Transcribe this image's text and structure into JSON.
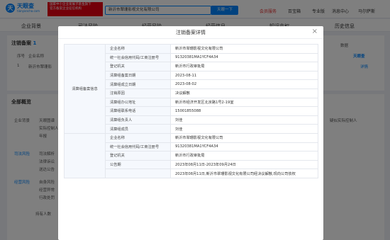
{
  "header": {
    "logo_mark": "天",
    "logo_name": "天眼查",
    "logo_url": "tianyancha.com",
    "promo_line1": "国家中小企业发展子基金旗下",
    "promo_line2": "官方备案企业征信机构",
    "search_value": "新沂市翠珊影视文化有限公司",
    "search_button": "天眼一下",
    "nav_vip": "会员服务",
    "nav_bt": "百宝箱",
    "nav_pro": "专业版",
    "nav_msg": "消息中心",
    "nav_user": "马尔萨斯"
  },
  "tabs": [
    "企业背景",
    "司法风险",
    "经营风险",
    "经营信息",
    "知识产权",
    "历史信息"
  ],
  "background": {
    "cancel_section": {
      "title": "注销备案",
      "count": "1"
    },
    "table_head": [
      "序号",
      "企业名称"
    ],
    "row": {
      "index": "1",
      "name_partial": "新沂市翠珊影"
    },
    "right_count_label": "数据",
    "right_more": "详情",
    "right_logo": "天眼查",
    "overview_title": "全部概览",
    "rows": [
      {
        "label": "企业背景",
        "sub": "天眼图谱",
        "sub2": "实际控制人",
        "sub3": "年报"
      },
      {
        "label": "司法风险",
        "sub": "司法解析",
        "sub2": "法律诉讼",
        "sub3": "送达公告"
      },
      {
        "label": "经营风险",
        "sub": "自身风险",
        "sub2": "经营异常",
        "sub3": "行政处罚"
      }
    ],
    "right_labels": [
      "疑似实际控制人"
    ],
    "tracking_label": "持有人数"
  },
  "modal": {
    "title": "注销备案详情",
    "group_label": "清算组备案信息",
    "rows": [
      {
        "label": "企业名称",
        "value": "新沂市翠珊影视文化有限公司"
      },
      {
        "label": "统一社会信用代码/工商注册号",
        "value": "91320381MA1YCF4A34"
      },
      {
        "label": "登记机关",
        "value": "新沂市行政审批局"
      },
      {
        "label": "清算组备案日期",
        "value": "2023-08-11"
      },
      {
        "label": "清算组成立日期",
        "value": "2023-08-02"
      },
      {
        "label": "注销原因",
        "value": "决议解散"
      },
      {
        "label": "清算组办公地址",
        "value": "新沂市经济开发区北京路1号2-19室"
      },
      {
        "label": "清算组联系电话",
        "value": "15001855088"
      },
      {
        "label": "清算组负责人",
        "value": "刘佳"
      },
      {
        "label": "清算组成员",
        "value": "刘佳"
      }
    ],
    "notice_rows": [
      {
        "label": "企业名称",
        "value": "新沂市翠珊影视文化有限公司"
      },
      {
        "label": "统一社会信用代码/工商注册号",
        "value": "91320381MA1YCF4A34"
      },
      {
        "label": "登记机关",
        "value": "新沂市行政审批局"
      },
      {
        "label": "公告期",
        "value": "2023年08月11日-2023年09月24日"
      },
      {
        "label": "",
        "value": "2023年08月11日,新沂市翠珊影视文化有限公司经决议解散,现向公司债权"
      }
    ]
  },
  "watermark": {
    "text": "@梨视频"
  },
  "colors": {
    "brand": "#0084ff",
    "vip": "#e62e2e",
    "promo": "#e60012"
  }
}
